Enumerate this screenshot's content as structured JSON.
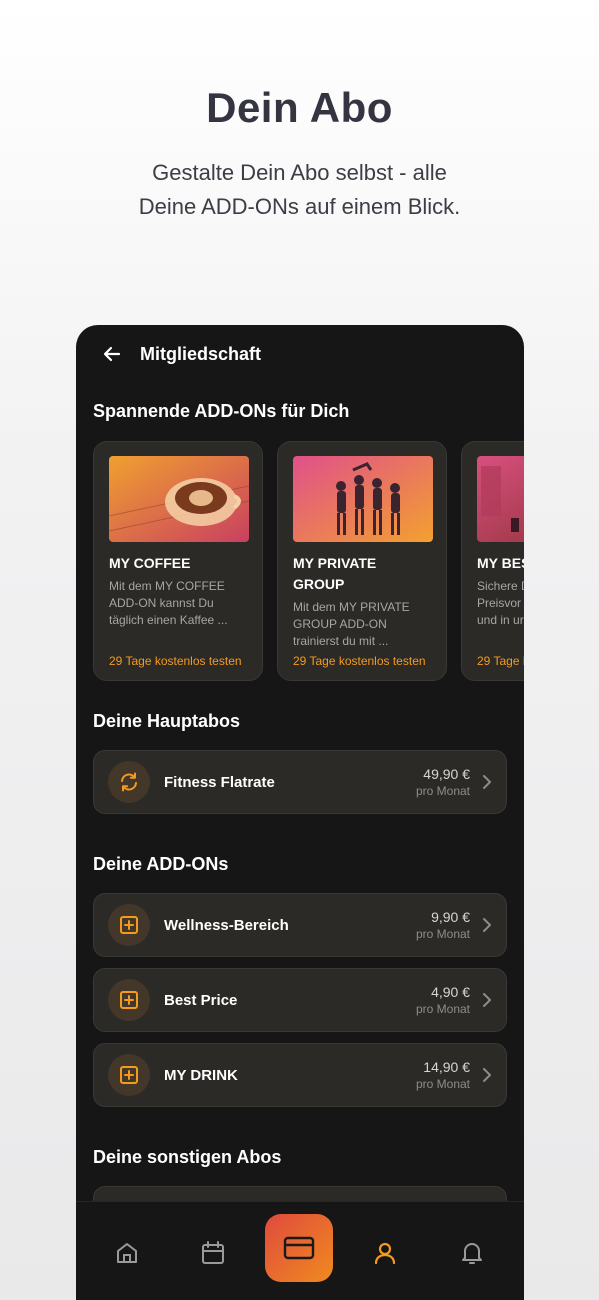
{
  "promo": {
    "title": "Dein Abo",
    "subtitle_line1": "Gestalte Dein Abo selbst - alle",
    "subtitle_line2": "Deine ADD-ONs auf einem Blick."
  },
  "header": {
    "title": "Mitgliedschaft",
    "back_icon": "arrow-left-icon"
  },
  "addons_section": {
    "title": "Spannende ADD-ONs für Dich",
    "cards": [
      {
        "title": "MY COFFEE",
        "description": "Mit dem MY COFFEE ADD-ON kannst Du täglich einen Kaffee ...",
        "cta": "29 Tage kostenlos testen"
      },
      {
        "title": "MY PRIVATE GROUP",
        "description": "Mit dem MY PRIVATE GROUP ADD-ON trainierst du mit ...",
        "cta": "29 Tage kostenlos testen"
      },
      {
        "title": "MY BES",
        "description": "Sichere D Preisvor und in ur",
        "cta": "29 Tage k"
      }
    ]
  },
  "main_subs": {
    "title": "Deine Hauptabos",
    "items": [
      {
        "label": "Fitness Flatrate",
        "price": "49,90 €",
        "period": "pro Monat",
        "icon": "refresh-icon"
      }
    ]
  },
  "my_addons": {
    "title": "Deine ADD-ONs",
    "items": [
      {
        "label": "Wellness-Bereich",
        "price": "9,90 €",
        "period": "pro Monat",
        "icon": "plus-square-icon"
      },
      {
        "label": "Best Price",
        "price": "4,90 €",
        "period": "pro Monat",
        "icon": "plus-square-icon"
      },
      {
        "label": "MY DRINK",
        "price": "14,90 €",
        "period": "pro Monat",
        "icon": "plus-square-icon"
      }
    ]
  },
  "other_subs": {
    "title": "Deine sonstigen Abos"
  },
  "nav": {
    "items": [
      "home-icon",
      "calendar-icon",
      "card-icon",
      "user-icon",
      "bell-icon"
    ],
    "active": "user-icon"
  },
  "colors": {
    "accent": "#f39a1f",
    "background": "#161616",
    "card": "#2c2a27"
  }
}
